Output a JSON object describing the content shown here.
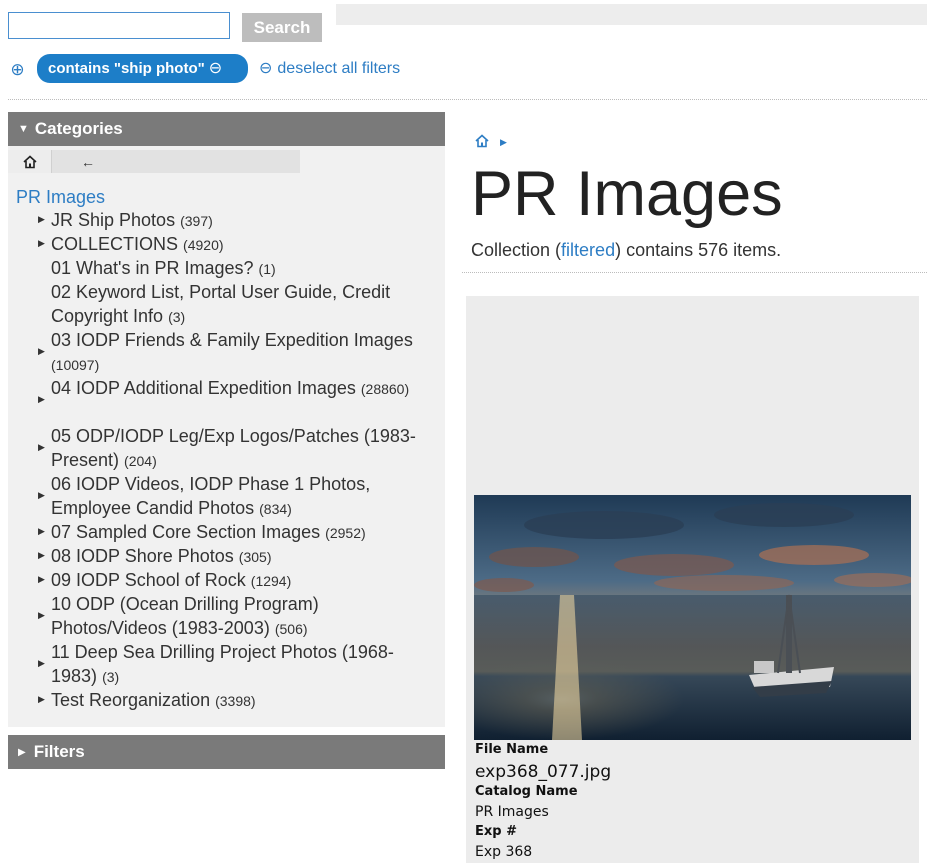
{
  "search": {
    "placeholder": "",
    "value": "",
    "button_label": "Search"
  },
  "filter_bar": {
    "add_filter_icon": "⊕",
    "active_filter": "contains \"ship photo\"",
    "remove_filter_icon": "⊖",
    "deselect_icon": "⊖",
    "deselect_label": "deselect all filters"
  },
  "sidebar": {
    "categories_title": "Categories",
    "filters_title": "Filters",
    "nav": {
      "home_icon": "home-icon",
      "back_icon": "←"
    },
    "root_label": "PR Images",
    "items": [
      {
        "label": "JR Ship Photos",
        "count": "(397)"
      },
      {
        "label": "COLLECTIONS",
        "count": "(4920)"
      },
      {
        "label": "01 What's in PR Images?",
        "count": "(1)"
      },
      {
        "label": "02 Keyword List, Portal User Guide, Credit Copyright Info",
        "count": "(3)"
      },
      {
        "label": "03 IODP Friends & Family Expedition Images",
        "count": "(10097)"
      },
      {
        "label": "04 IODP Additional Expedition Images",
        "count": "(28860)"
      },
      {
        "label": "05 ODP/IODP Leg/Exp Logos/Patches (1983-Present)",
        "count": "(204)"
      },
      {
        "label": "06 IODP Videos, IODP Phase 1 Photos, Employee Candid Photos",
        "count": "(834)"
      },
      {
        "label": "07 Sampled Core Section Images",
        "count": "(2952)"
      },
      {
        "label": "08 IODP Shore Photos",
        "count": "(305)"
      },
      {
        "label": "09 IODP School of Rock",
        "count": "(1294)"
      },
      {
        "label": "10 ODP (Ocean Drilling Program) Photos/Videos (1983-2003)",
        "count": "(506)"
      },
      {
        "label": "11 Deep Sea Drilling Project Photos (1968-1983)",
        "count": "(3)"
      },
      {
        "label": "Test Reorganization",
        "count": "(3398)"
      }
    ]
  },
  "main": {
    "breadcrumb_home_icon": "home-icon",
    "title": "PR Images",
    "summary": {
      "prefix": "Collection (",
      "link": "filtered",
      "suffix": ") contains 576 items."
    },
    "result": {
      "image_description": "drill ship at sea at sunset",
      "fields": [
        {
          "label": "File Name",
          "value": "exp368_077.jpg"
        },
        {
          "label": "Catalog Name",
          "value": "PR Images"
        },
        {
          "label": "Exp #",
          "value": "Exp 368"
        }
      ]
    }
  },
  "colors": {
    "link_blue": "#2d7dc4",
    "chip_blue": "#1d7ec8",
    "header_gray": "#7a7a7a",
    "panel_bg": "#f1f1f1",
    "card_bg": "#ececec",
    "button_gray": "#bdbdbd"
  }
}
